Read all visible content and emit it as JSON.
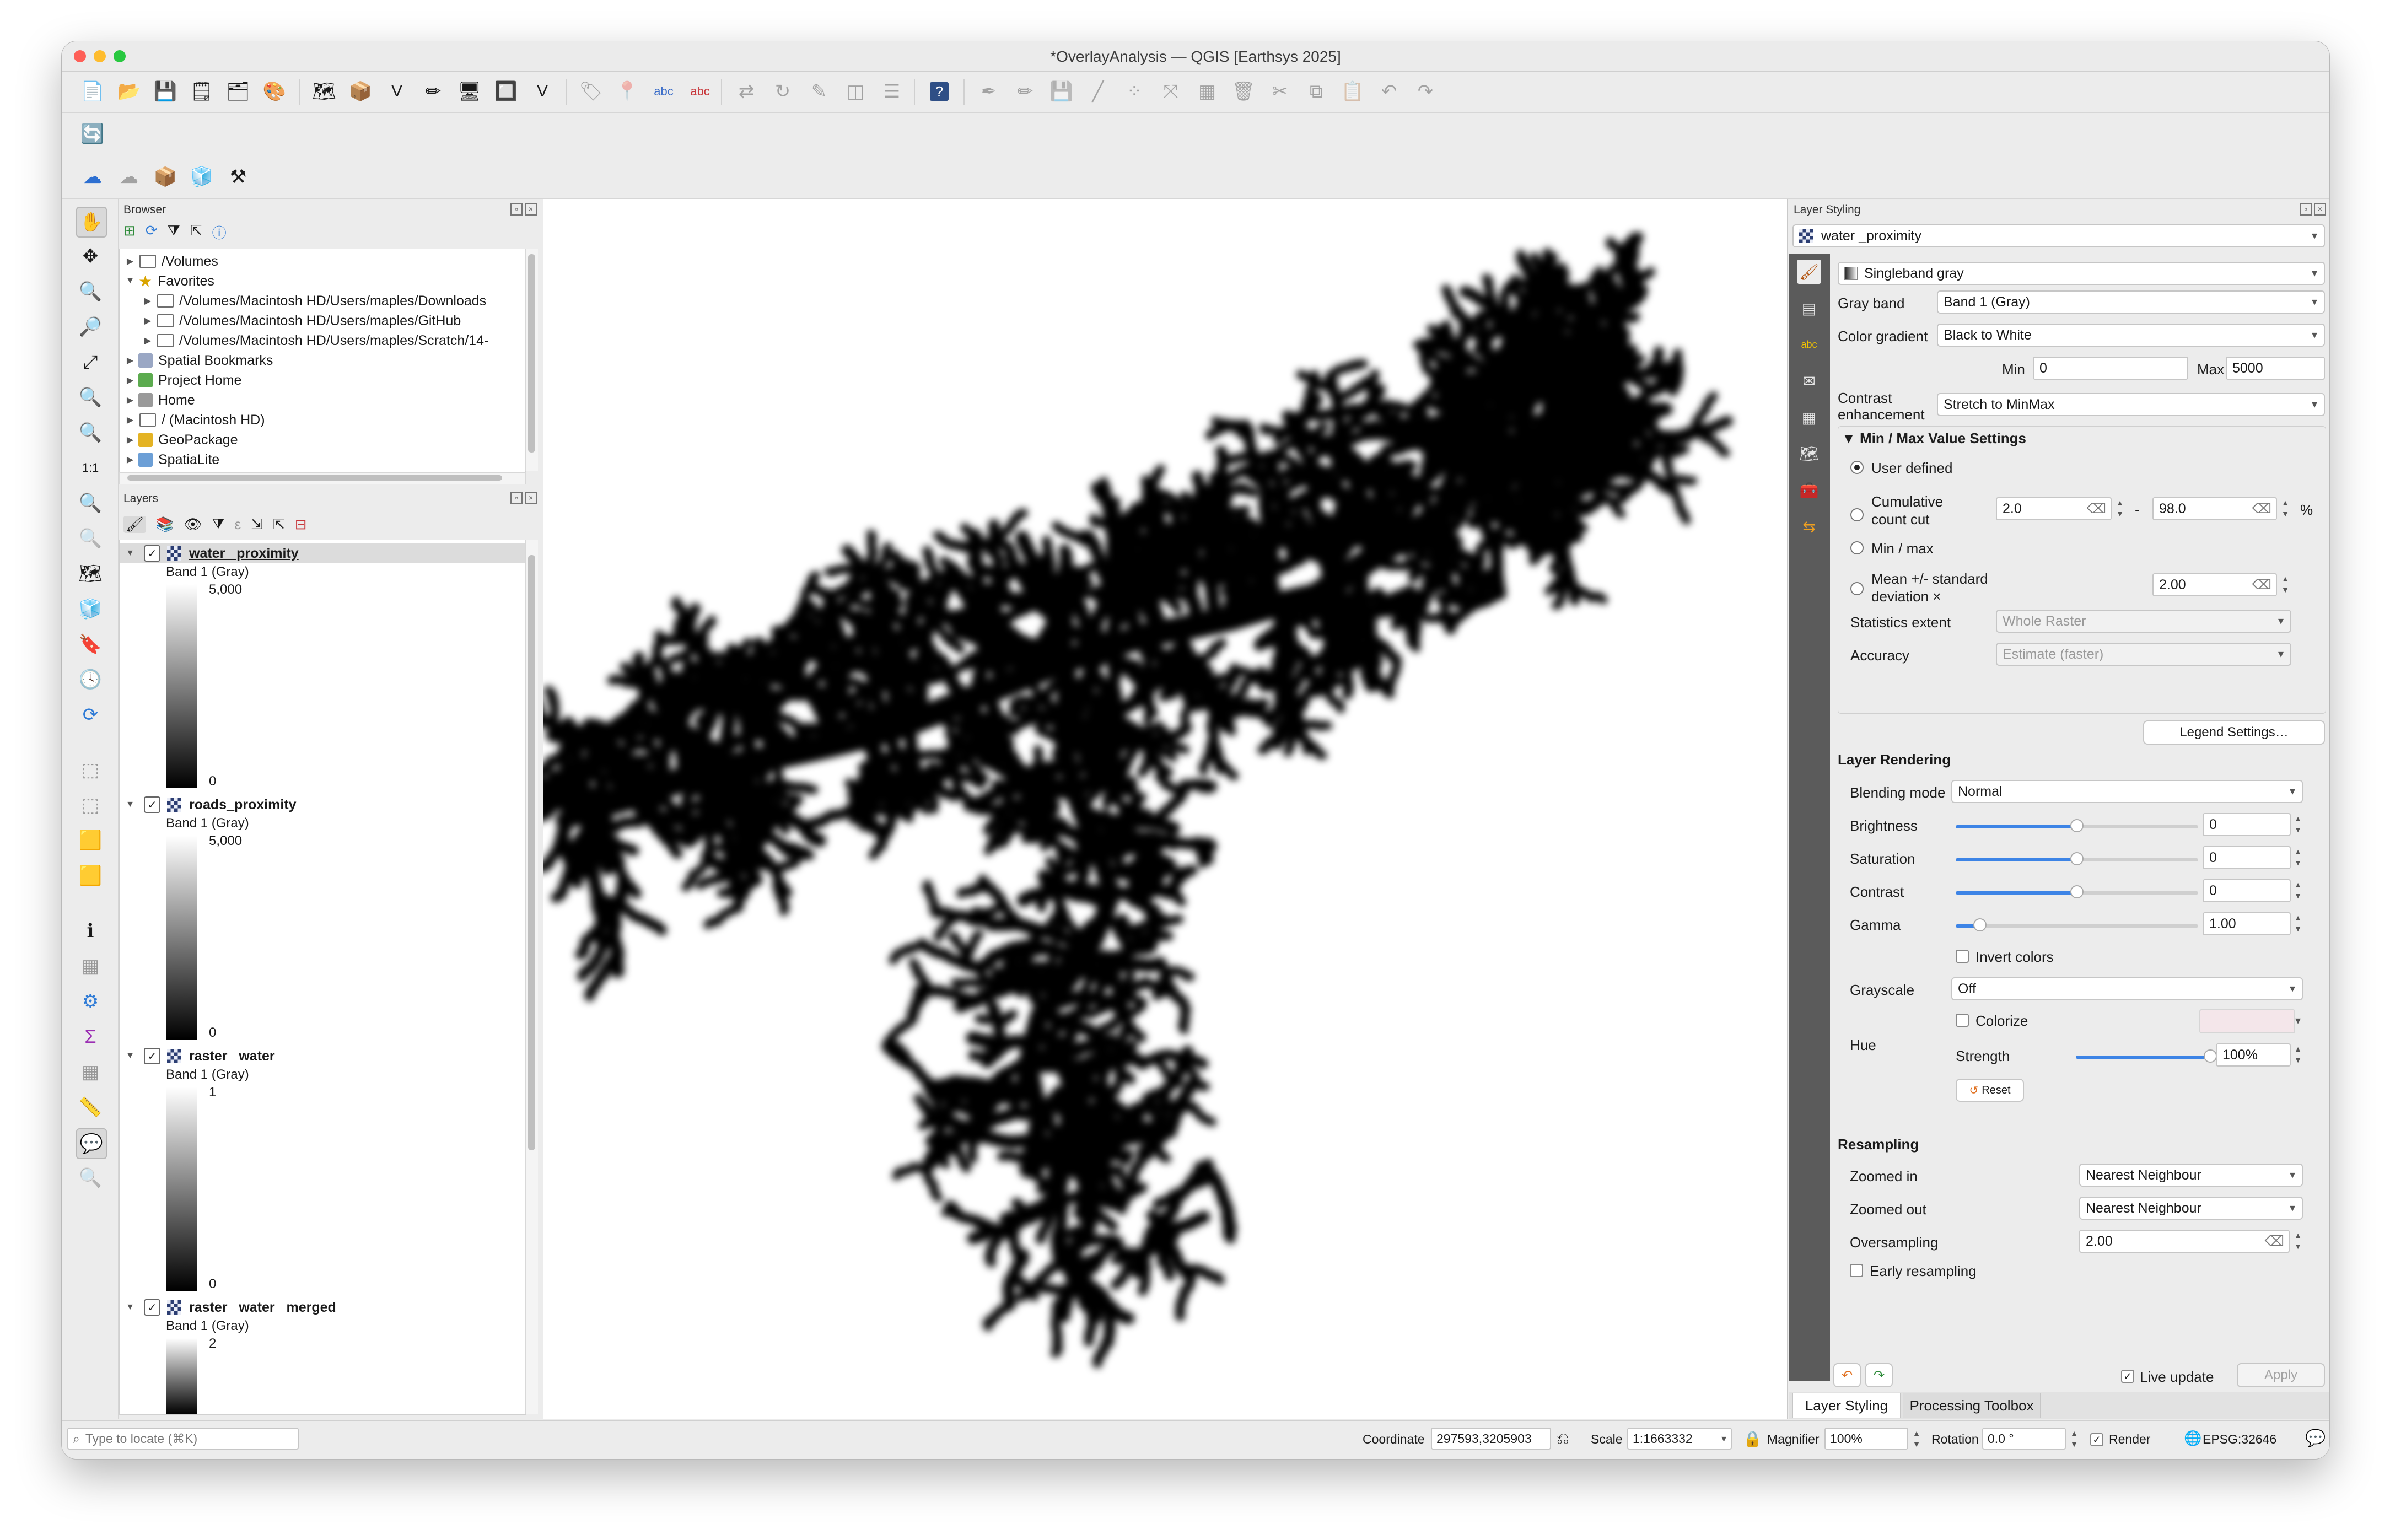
{
  "window": {
    "title": "*OverlayAnalysis — QGIS [Earthsys 2025]"
  },
  "browser": {
    "title": "Browser",
    "items": [
      {
        "label": "/Volumes",
        "indent": 0,
        "icon": "folder-icon",
        "expanded": false
      },
      {
        "label": "Favorites",
        "indent": 0,
        "icon": "star-icon",
        "expanded": true
      },
      {
        "label": "/Volumes/Macintosh HD/Users/maples/Downloads",
        "indent": 1,
        "icon": "folder-icon",
        "expanded": false
      },
      {
        "label": "/Volumes/Macintosh HD/Users/maples/GitHub",
        "indent": 1,
        "icon": "folder-icon",
        "expanded": false
      },
      {
        "label": "/Volumes/Macintosh HD/Users/maples/Scratch/14-",
        "indent": 1,
        "icon": "folder-icon",
        "expanded": false
      },
      {
        "label": "Spatial Bookmarks",
        "indent": 0,
        "icon": "bookmark-icon",
        "expanded": false
      },
      {
        "label": "Project Home",
        "indent": 0,
        "icon": "project-home-icon",
        "expanded": false
      },
      {
        "label": "Home",
        "indent": 0,
        "icon": "home-icon",
        "expanded": false
      },
      {
        "label": "/ (Macintosh HD)",
        "indent": 0,
        "icon": "folder-icon",
        "expanded": false
      },
      {
        "label": "GeoPackage",
        "indent": 0,
        "icon": "geopackage-icon",
        "expanded": false
      },
      {
        "label": "SpatiaLite",
        "indent": 0,
        "icon": "spatialite-icon",
        "expanded": false
      }
    ]
  },
  "layers": {
    "title": "Layers",
    "items": [
      {
        "name": "water _proximity",
        "band": "Band 1 (Gray)",
        "max": "5,000",
        "min": "0",
        "checked": true,
        "selected": true
      },
      {
        "name": "roads_proximity",
        "band": "Band 1 (Gray)",
        "max": "5,000",
        "min": "0",
        "checked": true,
        "selected": false
      },
      {
        "name": "raster _water",
        "band": "Band 1 (Gray)",
        "max": "1",
        "min": "0",
        "checked": true,
        "selected": false
      },
      {
        "name": "raster _water _merged",
        "band": "Band 1 (Gray)",
        "max": "2",
        "min": "",
        "checked": true,
        "selected": false
      }
    ]
  },
  "styling": {
    "title": "Layer Styling",
    "layer": "water _proximity",
    "renderer": "Singleband gray",
    "gray_band_label": "Gray band",
    "gray_band": "Band 1 (Gray)",
    "gradient_label": "Color gradient",
    "gradient": "Black to White",
    "min_label": "Min",
    "min": "0",
    "max_label": "Max",
    "max": "5000",
    "contrast_label": "Contrast enhancement",
    "contrast": "Stretch to MinMax",
    "minmax_title": "Min / Max Value Settings",
    "user_defined": "User defined",
    "cumulative": "Cumulative count cut",
    "cum_low": "2.0",
    "cum_high": "98.0",
    "percent": "%",
    "dash": "-",
    "minmax": "Min / max",
    "meanstd": "Mean +/- standard deviation ×",
    "meanstd_val": "2.00",
    "stats_extent_label": "Statistics extent",
    "stats_extent": "Whole Raster",
    "accuracy_label": "Accuracy",
    "accuracy": "Estimate (faster)",
    "legend_btn": "Legend Settings…",
    "rendering_title": "Layer Rendering",
    "blending_label": "Blending mode",
    "blending": "Normal",
    "brightness_label": "Brightness",
    "brightness": "0",
    "saturation_label": "Saturation",
    "saturation": "0",
    "contrast2_label": "Contrast",
    "contrast2": "0",
    "gamma_label": "Gamma",
    "gamma": "1.00",
    "invert_label": "Invert colors",
    "grayscale_label": "Grayscale",
    "grayscale": "Off",
    "hue_label": "Hue",
    "colorize_label": "Colorize",
    "strength_label": "Strength",
    "strength": "100%",
    "reset_btn": "Reset",
    "resampling_title": "Resampling",
    "zoomed_in_label": "Zoomed in",
    "zoomed_in": "Nearest Neighbour",
    "zoomed_out_label": "Zoomed out",
    "zoomed_out": "Nearest Neighbour",
    "oversampling_label": "Oversampling",
    "oversampling": "2.00",
    "early_label": "Early resampling",
    "live_update_label": "Live update",
    "apply_btn": "Apply",
    "tabs": [
      "Layer Styling",
      "Processing Toolbox"
    ],
    "levels": {
      "brightness": 0.5,
      "saturation": 0.5,
      "contrast": 0.5,
      "gamma": 0.1,
      "strength": 1.0
    }
  },
  "status": {
    "locate_placeholder": "Type to locate (⌘K)",
    "coordinate_label": "Coordinate",
    "coordinate": "297593,3205903",
    "scale_label": "Scale",
    "scale": "1:1663332",
    "magnifier_label": "Magnifier",
    "magnifier": "100%",
    "rotation_label": "Rotation",
    "rotation": "0.0 °",
    "render_label": "Render",
    "crs": "EPSG:32646"
  },
  "colors": {
    "accent": "#3d84e6",
    "selection": "#dcdcdc",
    "dock_bar": "#5b5b5b"
  }
}
